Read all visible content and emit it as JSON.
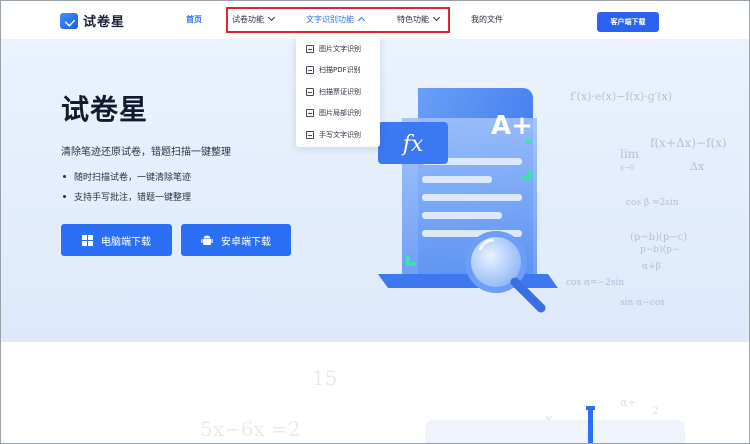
{
  "brand": {
    "name": "试卷星",
    "color": "#2b6ff5"
  },
  "nav": {
    "home": "首页",
    "exam_features": "试卷功能",
    "ocr_features": "文字识别功能",
    "special_features": "特色功能",
    "my_files": "我的文件"
  },
  "cta": "客户端下载",
  "dropdown": {
    "items": [
      "图片文字识别",
      "扫描PDF识别",
      "扫描票证识别",
      "图片局部识别",
      "手写文字识别"
    ]
  },
  "hero": {
    "title": "试卷星",
    "subtitle": "清除笔迹还原试卷，错题扫描一键整理",
    "bullets": [
      "随时扫描试卷，一键清除笔迹",
      "支持手写批注，错题一键整理"
    ],
    "btn_windows": "电脑端下载",
    "btn_android": "安卓端下载"
  },
  "illustration": {
    "badge_fx": "fx",
    "badge_grade": "A+"
  },
  "watermark": {
    "f1": "f′(x)·e(x)−f(x)·g′(x)",
    "f2": "f(x+Δx)−f(x)",
    "f3": "Δx",
    "f4": "lim",
    "f5": "x→0",
    "f6": "cos β =2sin",
    "f7": "(p−b)(p−c)",
    "f8": "α+β",
    "f9": "cos α=−2sin",
    "f10": "p−b)(p−",
    "f11": "sin α−cos",
    "l1": "15",
    "l2": "5x−6x =2",
    "l3": "x",
    "l4": "α+",
    "l5": "2"
  },
  "colors": {
    "accent": "#2b6ff5",
    "highlight_box": "#e0242f",
    "hero_bg": "#e3edfc"
  }
}
